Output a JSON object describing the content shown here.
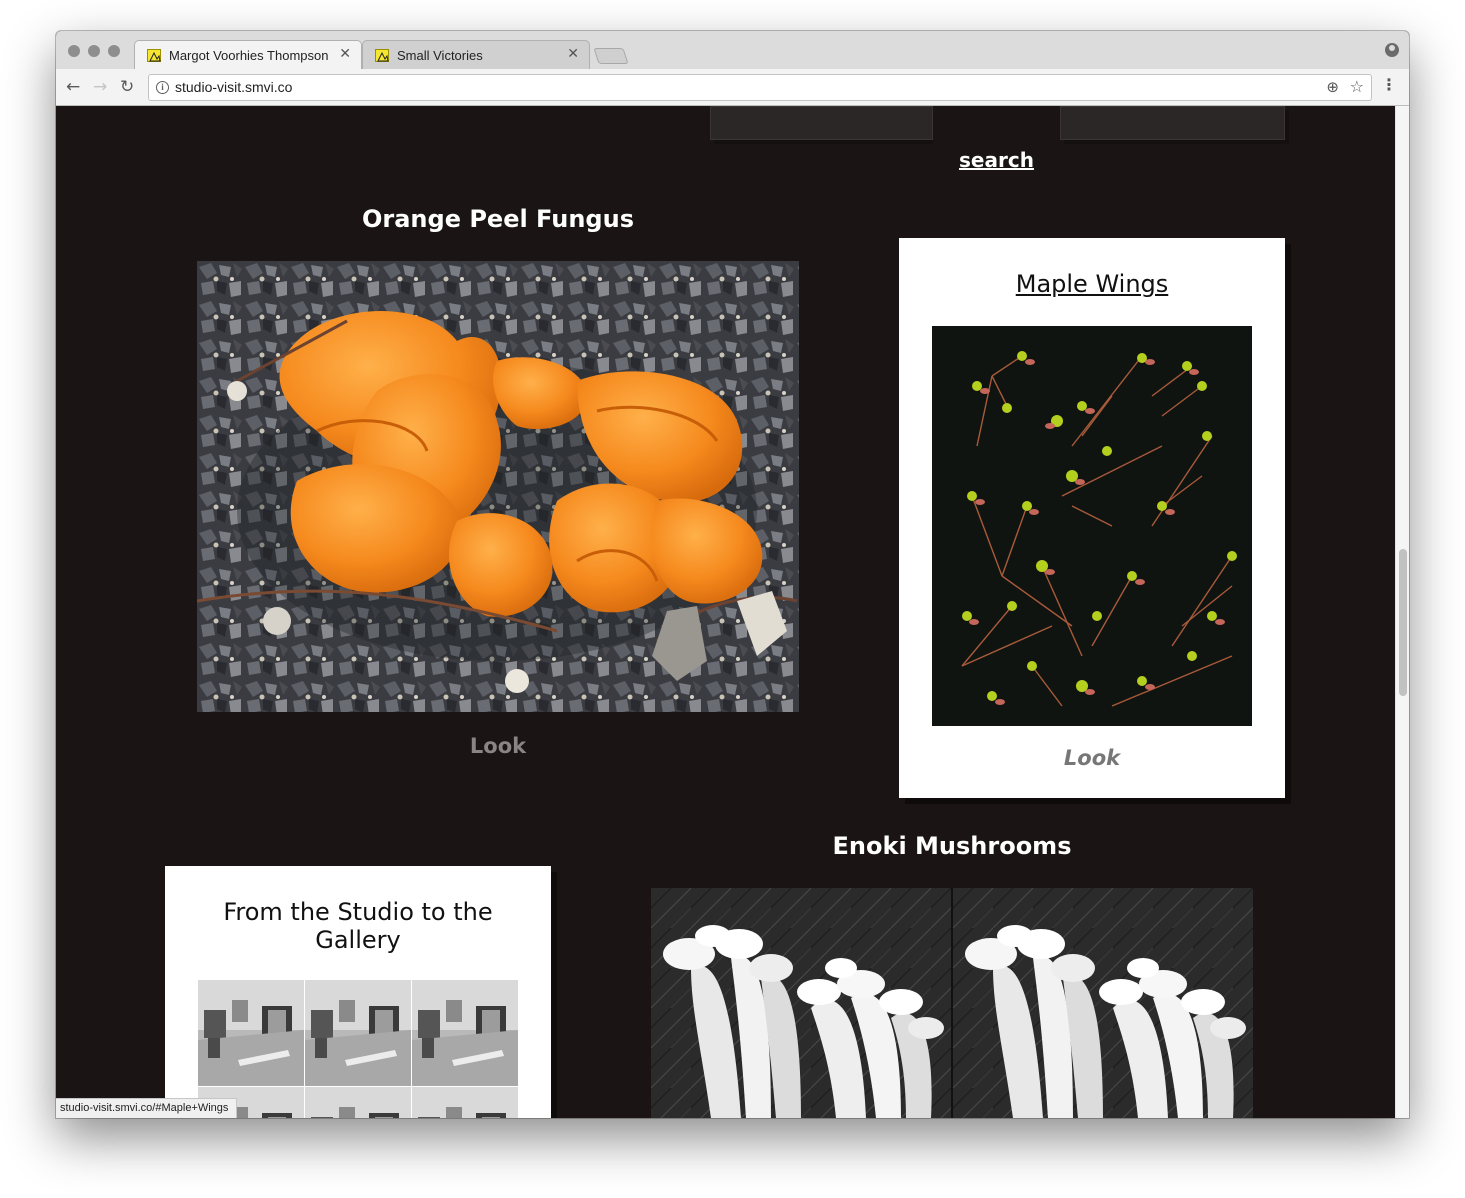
{
  "browser": {
    "tabs": [
      {
        "title": "Margot Voorhies Thompson",
        "close": "✕"
      },
      {
        "title": "Small Victories",
        "close": "✕"
      }
    ],
    "url": "studio-visit.smvi.co",
    "status_url": "studio-visit.smvi.co/#Maple+Wings",
    "nav": {
      "back": "←",
      "forward": "→",
      "reload": "↻"
    },
    "icons": {
      "info": "i",
      "zoom": "⊕",
      "star": "☆",
      "menu": "⋮"
    }
  },
  "page": {
    "search_link": "search",
    "cards": [
      {
        "title": "Orange Peel Fungus",
        "action": "Look",
        "style": "dark"
      },
      {
        "title": "Maple Wings",
        "action": "Look",
        "style": "light"
      },
      {
        "title": "From the Studio to the Gallery",
        "style": "light"
      },
      {
        "title": "Enoki Mushrooms",
        "style": "dark"
      }
    ]
  },
  "colors": {
    "page_background": "#1a1414",
    "card_background": "#ffffff",
    "fungus_orange": "#f28a1e"
  }
}
